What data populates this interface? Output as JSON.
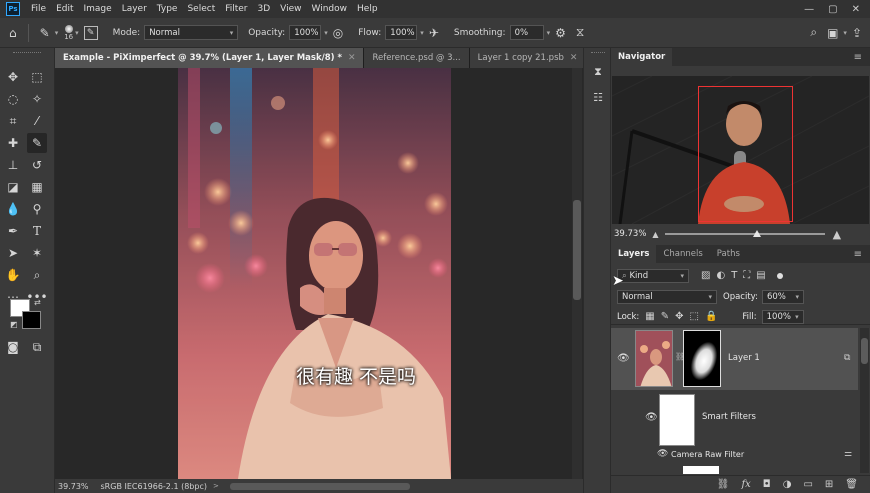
{
  "app_logo": "Ps",
  "menu": [
    "File",
    "Edit",
    "Image",
    "Layer",
    "Type",
    "Select",
    "Filter",
    "3D",
    "View",
    "Window",
    "Help"
  ],
  "window_controls": [
    "—",
    "▢",
    "✕"
  ],
  "options": {
    "brush_size": "16",
    "mode_label": "Mode:",
    "mode_value": "Normal",
    "opacity_label": "Opacity:",
    "opacity_value": "100%",
    "flow_label": "Flow:",
    "flow_value": "100%",
    "smoothing_label": "Smoothing:",
    "smoothing_value": "0%"
  },
  "tabs": [
    {
      "label": "Example - PiXimperfect @ 39.7% (Layer 1, Layer Mask/8) *",
      "active": true
    },
    {
      "label": "Reference.psd @ 3...",
      "active": false
    },
    {
      "label": "Layer 1 copy 21.psb",
      "active": false
    }
  ],
  "status": {
    "zoom": "39.73%",
    "profile": "sRGB IEC61966-2.1 (8bpc)"
  },
  "subtitle": "很有趣 不是吗",
  "navigator": {
    "title": "Navigator",
    "zoom": "39.73%"
  },
  "layers_panel": {
    "tabs": [
      "Layers",
      "Channels",
      "Paths"
    ],
    "filter_label": "Kind",
    "blend_mode": "Normal",
    "opacity_label": "Opacity:",
    "opacity_value": "60%",
    "lock_label": "Lock:",
    "fill_label": "Fill:",
    "fill_value": "100%",
    "layers": [
      {
        "name": "Layer 1",
        "visible": true
      },
      {
        "name": "Smart Filters",
        "visible": true
      },
      {
        "name": "Camera Raw Filter",
        "visible": true
      }
    ],
    "footer_fx": "fx"
  },
  "colors": {
    "accent": "#31a8ff",
    "panel_bg": "#3a3a3a",
    "dark_bg": "#2b2b2b"
  }
}
